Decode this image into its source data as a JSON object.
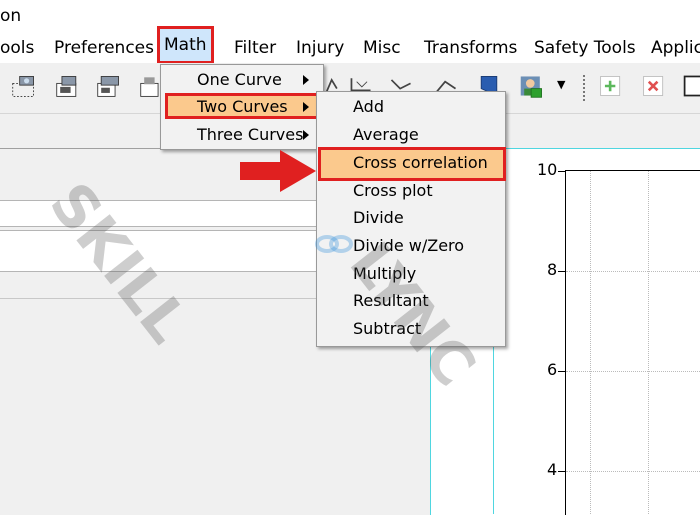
{
  "window": {
    "title_fragment": "on"
  },
  "menubar": {
    "items": [
      "ools",
      "Preferences",
      "Math",
      "Filter",
      "Injury",
      "Misc",
      "Transforms",
      "Safety Tools",
      "Applic"
    ]
  },
  "math_menu": {
    "items": [
      "One Curve",
      "Two Curves",
      "Three Curves"
    ]
  },
  "two_curves_menu": {
    "items": [
      "Add",
      "Average",
      "Cross correlation",
      "Cross plot",
      "Divide",
      "Divide w/Zero",
      "Multiply",
      "Resultant",
      "Subtract"
    ]
  },
  "plot": {
    "y_ticks": [
      "10",
      "8",
      "6",
      "4"
    ]
  },
  "watermark": {
    "left": "SKILL",
    "right": "LYNC"
  },
  "colors": {
    "highlight_red": "#e02020",
    "menu_hover": "#fbc98d",
    "menubar_hover": "#cfe6fb",
    "plot_border": "#4fd6e0"
  }
}
